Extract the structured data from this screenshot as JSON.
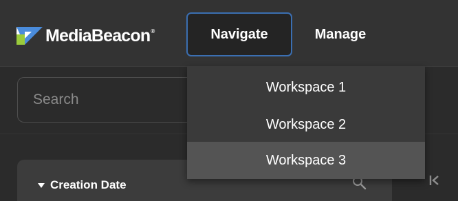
{
  "header": {
    "logo_text": "MediaBeacon",
    "logo_mark": "®",
    "nav": [
      {
        "label": "Navigate",
        "active": true
      },
      {
        "label": "Manage",
        "active": false
      }
    ]
  },
  "search": {
    "placeholder": "Search",
    "value": ""
  },
  "panel": {
    "title": "Creation Date",
    "icons": [
      "chevron-down-icon",
      "search-icon"
    ]
  },
  "sidebar_toggle_icon": "collapse-left-icon",
  "navigate_menu": {
    "open": true,
    "highlighted_index": 2,
    "items": [
      "Workspace 1",
      "Workspace 2",
      "Workspace 3"
    ]
  },
  "colors": {
    "accent_border": "#3b6fb2",
    "logo_blue": "#4a8cdc",
    "logo_green": "#9acb3c",
    "highlight": "#545454"
  }
}
